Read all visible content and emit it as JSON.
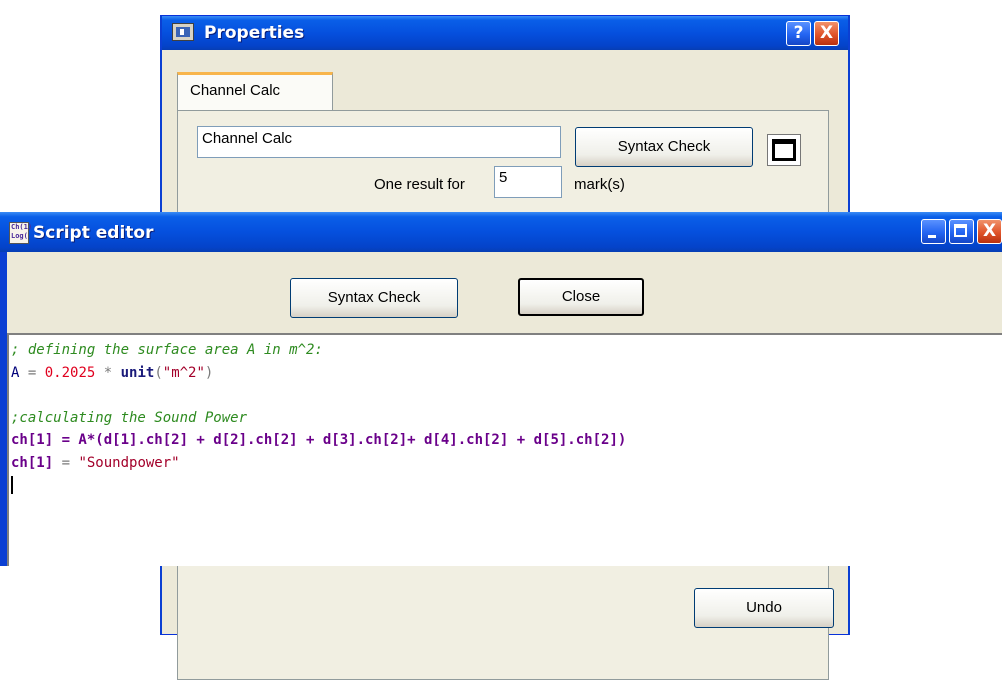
{
  "properties_window": {
    "title": "Properties",
    "help_glyph": "?",
    "close_glyph": "X",
    "tab_label": "Channel Calc",
    "name_field_value": "Channel Calc",
    "syntax_check_label": "Syntax Check",
    "one_result_for_label": "One result for",
    "marks_field_value": "5",
    "marks_unit_label": "mark(s)",
    "undo_label": "Undo",
    "icons": {
      "window": "properties-window-icon",
      "toggle": "panel-toggle-icon"
    }
  },
  "script_editor": {
    "title": "Script editor",
    "icon_text": "Ch(1) Log(",
    "syntax_check_label": "Syntax Check",
    "close_label": "Close",
    "code": {
      "line1": "; defining the surface area A in m^2:",
      "line2_id": "A",
      "line2_eq": " = ",
      "line2_num": "0.2025",
      "line2_mul": " * ",
      "line2_fn": "unit",
      "line2_open": "(",
      "line2_str": "\"m^2\"",
      "line2_close": ")",
      "line4": ";calculating the Sound Power",
      "line5": "ch[1] = A*(d[1].ch[2] + d[2].ch[2] + d[3].ch[2]+ d[4].ch[2] + d[5].ch[2])",
      "line6_left": "ch[1]",
      "line6_eq": " = ",
      "line6_str": "\"Soundpower\""
    }
  },
  "colors": {
    "titlebar_blue": "#0550de",
    "close_red": "#e0542a",
    "comment_green": "#2e8b20",
    "number_red": "#e0001e",
    "string_red": "#a3002a"
  }
}
